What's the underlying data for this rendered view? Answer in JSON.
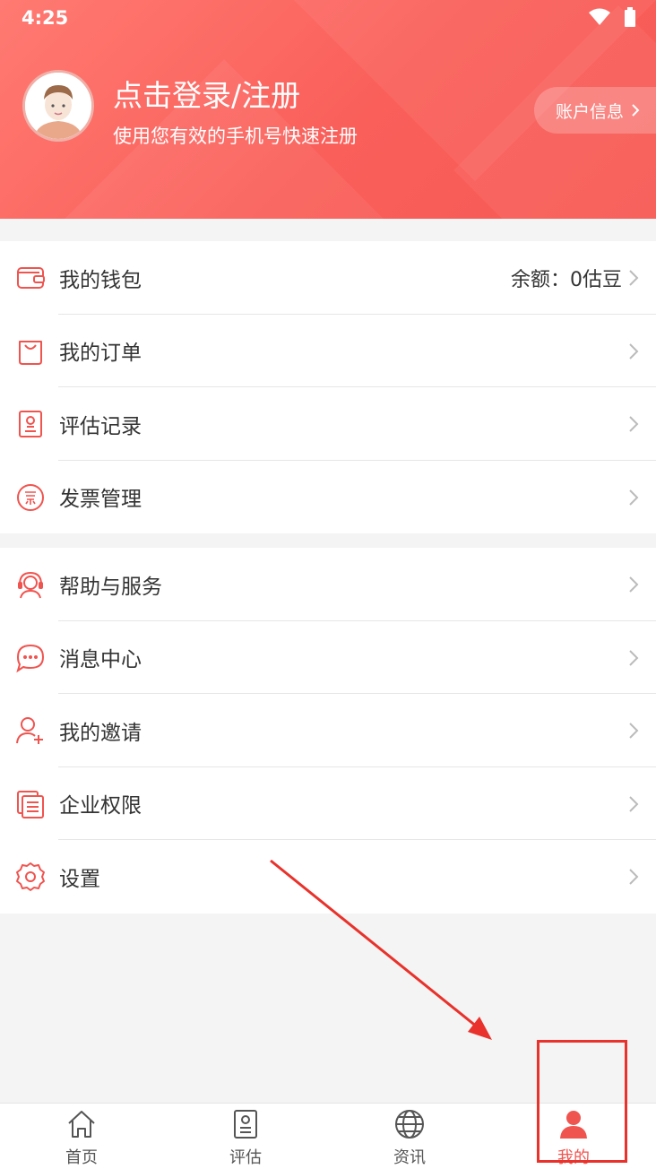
{
  "status_bar": {
    "time": "4:25",
    "wifi_icon": "wifi-icon",
    "battery_icon": "battery-icon"
  },
  "header": {
    "login_title": "点击登录/注册",
    "login_subtitle": "使用您有效的手机号快速注册",
    "account_button": "账户信息",
    "accent_color": "#fa5f5a"
  },
  "group1": [
    {
      "label": "我的钱包",
      "value": "余额：0估豆",
      "icon": "wallet-icon"
    },
    {
      "label": "我的订单",
      "value": "",
      "icon": "order-bag-icon"
    },
    {
      "label": "评估记录",
      "value": "",
      "icon": "record-icon"
    },
    {
      "label": "发票管理",
      "value": "",
      "icon": "invoice-icon"
    }
  ],
  "group2": [
    {
      "label": "帮助与服务",
      "icon": "headset-icon"
    },
    {
      "label": "消息中心",
      "icon": "message-icon"
    },
    {
      "label": "我的邀请",
      "icon": "invite-user-icon"
    },
    {
      "label": "企业权限",
      "icon": "enterprise-icon"
    },
    {
      "label": "设置",
      "icon": "settings-icon"
    }
  ],
  "bottom_nav": [
    {
      "label": "首页",
      "icon": "home-icon",
      "active": false
    },
    {
      "label": "评估",
      "icon": "evaluate-icon",
      "active": false
    },
    {
      "label": "资讯",
      "icon": "globe-icon",
      "active": false
    },
    {
      "label": "我的",
      "icon": "person-icon",
      "active": true
    }
  ]
}
